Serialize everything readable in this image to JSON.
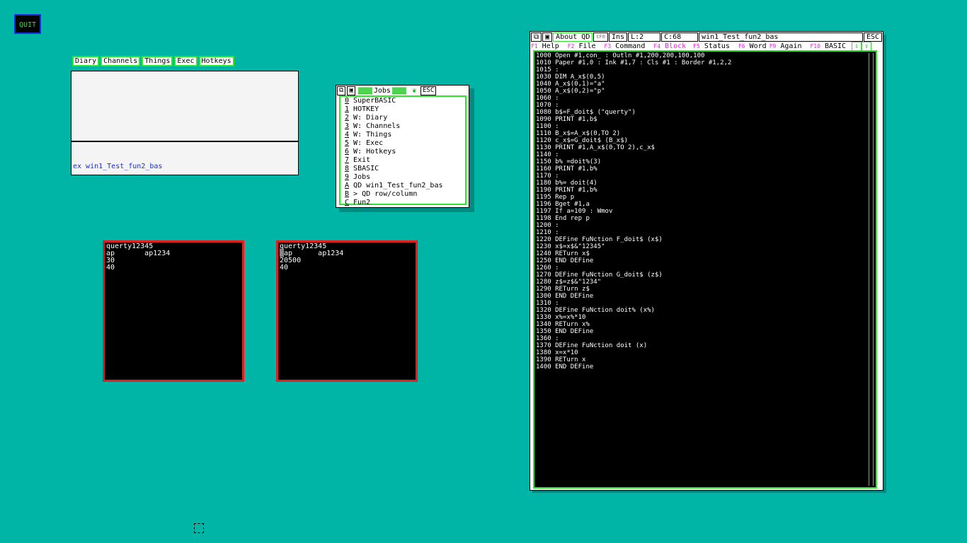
{
  "quit_label": "QUIT",
  "hotkey_tabs": [
    "Diary",
    "Channels",
    "Things",
    "Exec",
    "Hotkeys"
  ],
  "panel": {
    "command_line": "ex win1_Test_fun2_bas"
  },
  "jobs_window": {
    "title": "Jobs",
    "esc_label": "ESC",
    "items": [
      {
        "key": "0",
        "label": " SuperBASIC"
      },
      {
        "key": "1",
        "label": " HOTKEY"
      },
      {
        "key": "2",
        "label": " W: Diary"
      },
      {
        "key": "3",
        "label": " W: Channels"
      },
      {
        "key": "4",
        "label": " W: Things"
      },
      {
        "key": "5",
        "label": " W: Exec"
      },
      {
        "key": "6",
        "label": " W: Hotkeys"
      },
      {
        "key": "7",
        "label": " Exit"
      },
      {
        "key": "8",
        "label": " SBASIC"
      },
      {
        "key": "9",
        "label": " Jobs"
      },
      {
        "key": "A",
        "label": " QD win1_Test_fun2_bas"
      },
      {
        "key": "B",
        "label": " > QD row/column"
      },
      {
        "key": "C",
        "label": " Fun2"
      }
    ]
  },
  "output_windows": [
    {
      "text": "querty12345\nap       ap1234\n30\n40"
    },
    {
      "text": "querty12345\n▒ap      ap1234\n20500\n40"
    }
  ],
  "editor": {
    "about": "About QD",
    "cf6": "CF6",
    "ins": "Ins",
    "line": "L:2",
    "col": "C:68",
    "filename": "win1_Test_fun2_bas",
    "esc": "ESC",
    "menu": [
      {
        "key": "F1",
        "label": "Help"
      },
      {
        "key": "F2",
        "label": "File"
      },
      {
        "key": "F3",
        "label": "Command"
      },
      {
        "key": "F4",
        "label": "Block"
      },
      {
        "key": "F5",
        "label": "Status"
      },
      {
        "key": "F6",
        "label": "Word"
      },
      {
        "key": "F9",
        "label": "Again"
      },
      {
        "key": "F10",
        "label": "BASIC"
      }
    ],
    "code": "1000 Open #1,con_ : Outln #1,200,200,100,100\n1010 Paper #1,0 : Ink #1,7 : Cls #1 : Border #1,2,2\n1015 :\n1030 DIM A_x$(0,5)\n1040 A_x$(0,1)=\"a\"\n1050 A_x$(0,2)=\"p\"\n1060 :\n1070 :\n1080 b$=F_doit$ (\"querty\")\n1090 PRINT #1,b$\n1100 :\n1110 B_x$=A_x$(0,TO 2)\n1120 c_x$=G_doit$ (B_x$)\n1130 PRINT #1,A_x$(0,TO 2),c_x$\n1140 :\n1150 b% =doit%(3)\n1160 PRINT #1,b%\n1170 :\n1180 b%= doit(4)\n1190 PRINT #1,b%\n1195 Rep p\n1196 Bget #1,a\n1197 If a=109 : Wmov\n1198 End rep p\n1200 :\n1210 :\n1220 DEFine FuNction F_doit$ (x$)\n1230 x$=x$&\"12345\"\n1240 RETurn x$\n1250 END DEFine\n1260 :\n1270 DEFine FuNction G_doit$ (z$)\n1280 z$=z$&\"1234\"\n1290 RETurn z$\n1300 END DEFine\n1310 :\n1320 DEFine FuNction doit% (x%)\n1330 x%=x%*10\n1340 RETurn x%\n1350 END DEFine\n1360 :\n1370 DEFine FuNction doit (x)\n1380 x=x*10\n1390 RETurn x\n1400 END DEFine"
  },
  "colors": {
    "desktop": "#00b5a6",
    "accent_green": "#2ee42e",
    "border_red": "#e02020",
    "fkey_magenta": "#e020e0"
  }
}
